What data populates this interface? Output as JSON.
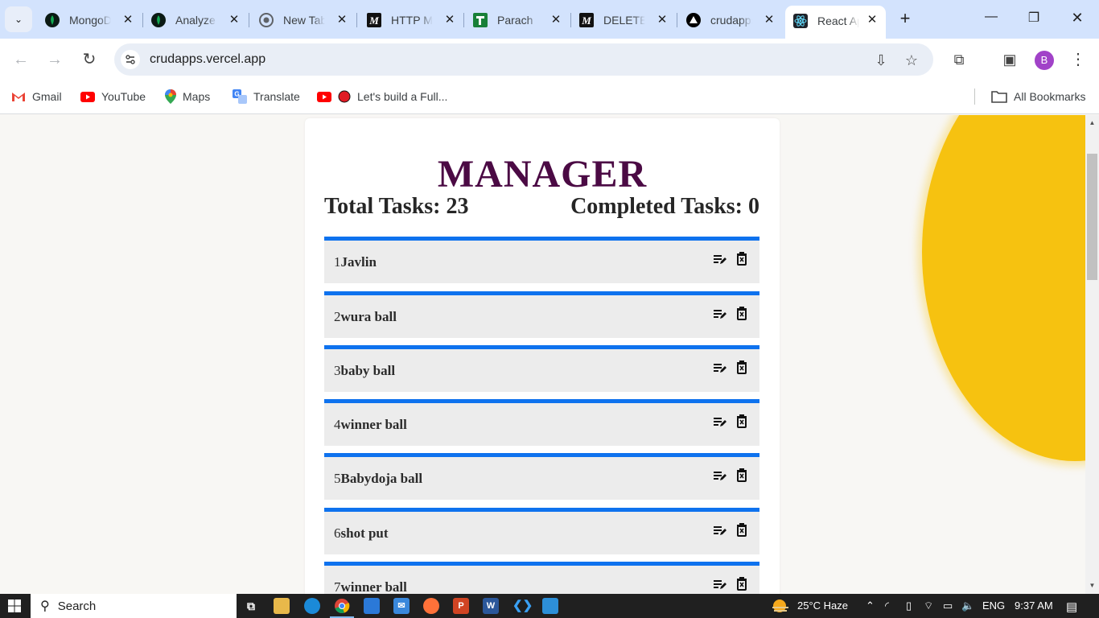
{
  "browser": {
    "tabs": [
      {
        "title": "MongoDB",
        "icon": "mongodb-leaf-icon"
      },
      {
        "title": "Analyze",
        "icon": "mongodb-leaf-icon"
      },
      {
        "title": "New Tab",
        "icon": "chrome-icon"
      },
      {
        "title": "HTTP Methods",
        "icon": "medium-icon"
      },
      {
        "title": "Parach",
        "icon": "sheets-icon"
      },
      {
        "title": "DELETE",
        "icon": "medium-icon"
      },
      {
        "title": "crudapps",
        "icon": "vercel-icon"
      },
      {
        "title": "React App",
        "icon": "react-icon",
        "active": true
      }
    ],
    "url": "crudapps.vercel.app",
    "profile_initial": "B",
    "bookmarks": [
      {
        "label": "Gmail",
        "icon": "gmail-icon"
      },
      {
        "label": "YouTube",
        "icon": "youtube-icon"
      },
      {
        "label": "Maps",
        "icon": "maps-icon"
      },
      {
        "label": "Translate",
        "icon": "translate-icon"
      },
      {
        "label": "Let's build a Full...",
        "icon": "youtube-icon"
      }
    ],
    "all_bookmarks_label": "All Bookmarks"
  },
  "app": {
    "title": "MANAGER",
    "total_tasks_label": "Total Tasks: 23",
    "completed_tasks_label": "Completed Tasks: 0",
    "tasks": [
      {
        "num": "1",
        "text": "Javlin"
      },
      {
        "num": "2",
        "text": "wura ball"
      },
      {
        "num": "3",
        "text": "baby ball"
      },
      {
        "num": "4",
        "text": "winner ball"
      },
      {
        "num": "5",
        "text": "Babydoja ball"
      },
      {
        "num": "6",
        "text": "shot put"
      },
      {
        "num": "7",
        "text": "winner ball"
      }
    ],
    "accent_color": "#0e72ee",
    "title_color": "#4b0a44"
  },
  "taskbar": {
    "search_placeholder": "Search",
    "weather": "25°C  Haze",
    "language": "ENG",
    "time": "9:37 AM"
  }
}
